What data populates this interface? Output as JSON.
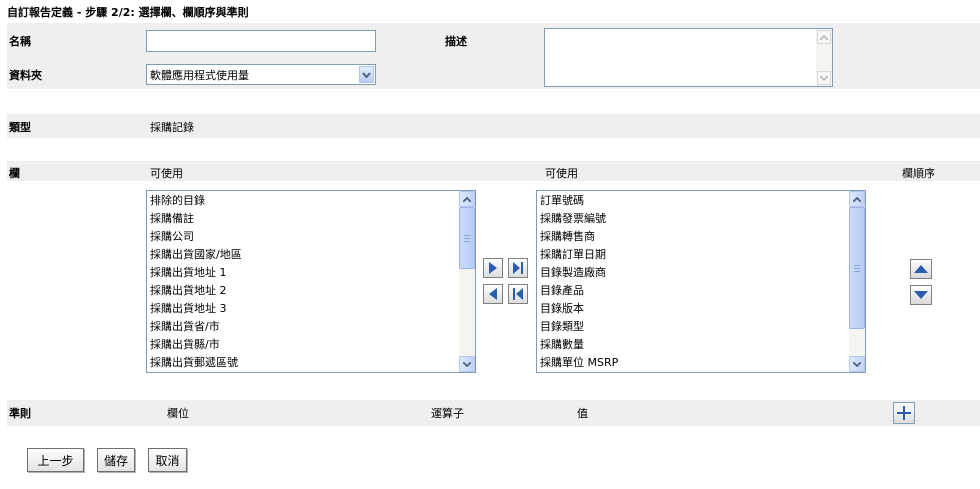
{
  "header": {
    "title": "自訂報告定義 - 步驟 2/2: 選擇欄、欄順序與準則"
  },
  "form": {
    "name_label": "名稱",
    "name_value": "",
    "description_label": "描述",
    "description_value": "",
    "folder_label": "資料夾",
    "folder_selected": "軟體應用程式使用量",
    "type_label": "類型",
    "type_value": "採購記錄"
  },
  "columns": {
    "section_label": "欄",
    "available_label": "可使用",
    "selected_label": "可使用",
    "order_label": "欄順序",
    "available_items": [
      "排除的目錄",
      "採購備註",
      "採購公司",
      "採購出貨國家/地區",
      "採購出貨地址 1",
      "採購出貨地址 2",
      "採購出貨地址 3",
      "採購出貨省/市",
      "採購出貨縣/市",
      "採購出貨郵遞區號"
    ],
    "selected_items": [
      "訂單號碼",
      "採購發票編號",
      "採購轉售商",
      "採購訂單日期",
      "目錄製造廠商",
      "目錄產品",
      "目錄版本",
      "目錄類型",
      "採購數量",
      "採購單位 MSRP"
    ]
  },
  "criteria": {
    "section_label": "準則",
    "field_header": "欄位",
    "operator_header": "運算子",
    "value_header": "值"
  },
  "buttons": {
    "back": "上一步",
    "save": "儲存",
    "cancel": "取消"
  },
  "colors": {
    "band": "#efefef",
    "arrow_blue": "#2a5db0",
    "input_border": "#7f9db9"
  }
}
